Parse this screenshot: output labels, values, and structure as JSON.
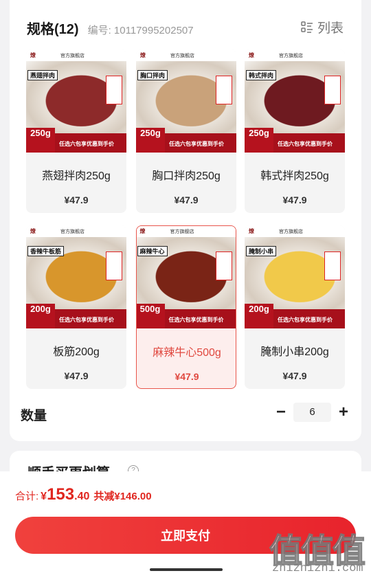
{
  "spec": {
    "title": "规格(12)",
    "code": "编号: 10117995202507",
    "view_toggle_label": "列表"
  },
  "products": [
    {
      "name": "燕翅拌肉250g",
      "price": "¥47.9",
      "tag": "燕翅拌肉",
      "weight": "250g",
      "selected": false,
      "photo_color": "#8d2a2a"
    },
    {
      "name": "胸口拌肉250g",
      "price": "¥47.9",
      "tag": "胸口拌肉",
      "weight": "250g",
      "selected": false,
      "photo_color": "#c9a27a"
    },
    {
      "name": "韩式拌肉250g",
      "price": "¥47.9",
      "tag": "韩式拌肉",
      "weight": "250g",
      "selected": false,
      "photo_color": "#6e1a20"
    },
    {
      "name": "板筋200g",
      "price": "¥47.9",
      "tag": "香辣牛板筋",
      "weight": "200g",
      "selected": false,
      "photo_color": "#d8962c"
    },
    {
      "name": "麻辣牛心500g",
      "price": "¥47.9",
      "tag": "麻辣牛心",
      "weight": "500g",
      "selected": true,
      "photo_color": "#7a2416"
    },
    {
      "name": "腌制小串200g",
      "price": "¥47.9",
      "tag": "腌制小串",
      "weight": "200g",
      "selected": false,
      "photo_color": "#f1c94a"
    }
  ],
  "thumb_common": {
    "shop": "官方旗舰店",
    "promo": "任选六包享优惠到手价"
  },
  "quantity": {
    "label": "数量",
    "minus": "−",
    "value": "6",
    "plus": "+"
  },
  "addon": {
    "title": "顺手买更划算"
  },
  "total": {
    "label": "合计:",
    "currency": "¥",
    "integer": "153",
    "decimal": ".40",
    "saving": "共减¥146.00"
  },
  "pay_button": "立即支付",
  "watermark": {
    "glyphs": "值值值",
    "text": "zhizhizhi.com"
  },
  "colors": {
    "accent": "#e8232c",
    "price_red": "#e0261f",
    "selected_border": "#e8554b"
  }
}
